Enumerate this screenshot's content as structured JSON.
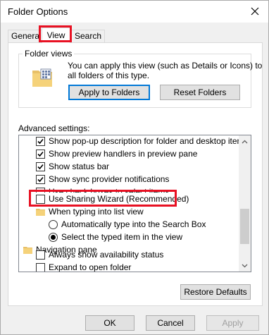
{
  "window": {
    "title": "Folder Options"
  },
  "tabs": [
    {
      "label": "General"
    },
    {
      "label": "View"
    },
    {
      "label": "Search"
    }
  ],
  "folder_views": {
    "label": "Folder views",
    "description_line1": "You can apply this view (such as Details or Icons) to",
    "description_line2": "all folders of this type.",
    "apply_button": "Apply to Folders",
    "reset_button": "Reset Folders"
  },
  "advanced": {
    "label": "Advanced settings:",
    "items": [
      {
        "text": "Show pop-up description for folder and desktop items",
        "type": "checkbox",
        "checked": true
      },
      {
        "text": "Show preview handlers in preview pane",
        "type": "checkbox",
        "checked": true
      },
      {
        "text": "Show status bar",
        "type": "checkbox",
        "checked": true
      },
      {
        "text": "Show sync provider notifications",
        "type": "checkbox",
        "checked": true
      },
      {
        "text": "Use check boxes to select items",
        "type": "checkbox",
        "checked": false
      },
      {
        "text": "Use Sharing Wizard (Recommended)",
        "type": "checkbox",
        "checked": false
      },
      {
        "text": "When typing into list view",
        "type": "folder"
      },
      {
        "text": "Automatically type into the Search Box",
        "type": "radio",
        "checked": false
      },
      {
        "text": "Select the typed item in the view",
        "type": "radio",
        "checked": true
      },
      {
        "text": "Navigation pane",
        "type": "folder"
      },
      {
        "text": "Always show availability status",
        "type": "checkbox",
        "checked": false
      },
      {
        "text": "Expand to open folder",
        "type": "checkbox",
        "checked": false
      }
    ]
  },
  "restore_button": "Restore Defaults",
  "footer": {
    "ok": "OK",
    "cancel": "Cancel",
    "apply": "Apply"
  },
  "colors": {
    "highlight": "#e81123",
    "focus": "#0078d7"
  }
}
